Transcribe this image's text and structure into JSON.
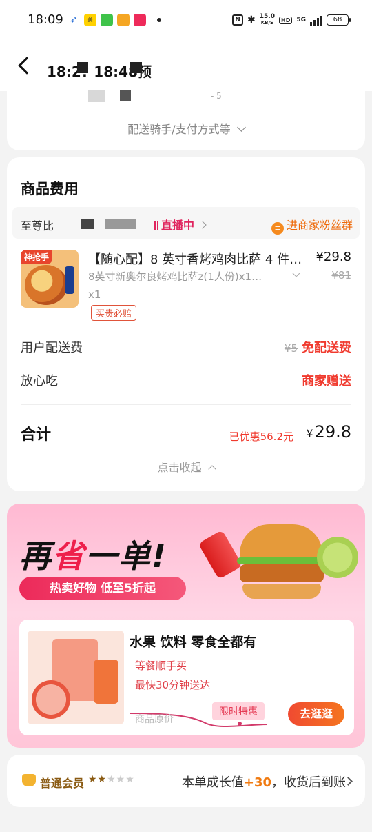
{
  "status_bar": {
    "time": "18:09",
    "app_icons": [
      "bird-icon",
      "meituan-icon",
      "message-icon",
      "mail-icon",
      "video-icon"
    ],
    "speed_value": "15.0",
    "speed_unit": "KB/S",
    "hd": "HD",
    "network": "5G",
    "battery": "68"
  },
  "header": {
    "title": "18:2? 18:48预"
  },
  "top_card": {
    "partial_text": "- 5",
    "delivery_toggle": "配送骑手/支付方式等"
  },
  "fee_section": {
    "title": "商品费用",
    "shop_name": "至尊比",
    "live_label": "直播中",
    "fans_label": "进商家粉丝群",
    "product": {
      "image_tag": "神抢手",
      "name": "【随心配】8 英寸香烤鸡肉比萨 4 件…",
      "price": "¥29.8",
      "spec": "8英寸新奥尔良烤鸡比萨z(1人份)x1…",
      "orig_price": "¥81",
      "qty": "x1",
      "badge": "买贵必赔"
    },
    "delivery_fee": {
      "label": "用户配送费",
      "orig": "¥5",
      "value": "免配送费"
    },
    "peace": {
      "label": "放心吃",
      "value": "商家赠送"
    },
    "total": {
      "label": "合计",
      "saved": "已优惠56.2元",
      "currency": "¥",
      "amount": "29.8"
    },
    "collapse_label": "点击收起"
  },
  "promo": {
    "title_a": "再",
    "title_hl": "省",
    "title_b": "一单!",
    "subtitle": "热卖好物 低至5折起",
    "inner_title": "水果 饮料 零食全都有",
    "line1": "等餐顺手买",
    "line2": "最快30分钟送达",
    "orig_price_label": "商品原价",
    "special_label": "限时特惠",
    "button": "去逛逛"
  },
  "member": {
    "name": "普通会员",
    "stars_on": 2,
    "stars_total": 5,
    "text_a": "本单成长值",
    "growth": "+30",
    "text_b": "，收货后到账"
  }
}
